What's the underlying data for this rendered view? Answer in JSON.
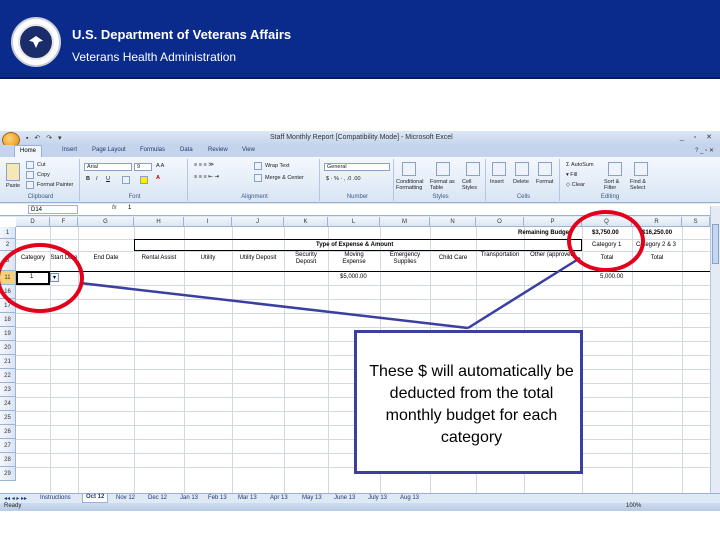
{
  "header": {
    "title": "U.S. Department of Veterans Affairs",
    "subtitle": "Veterans Health Administration"
  },
  "window": {
    "title": "Staff Monthly Report [Compatibility Mode] - Microsoft Excel"
  },
  "ribbon": {
    "tabs": [
      "Home",
      "Insert",
      "Page Layout",
      "Formulas",
      "Data",
      "Review",
      "View"
    ],
    "active_tab": "Home",
    "clipboard": {
      "label": "Clipboard",
      "paste": "Paste",
      "cut": "Cut",
      "copy": "Copy",
      "format_painter": "Format Painter"
    },
    "font": {
      "label": "Font",
      "name": "Arial",
      "size": "9"
    },
    "alignment": {
      "label": "Alignment",
      "wrap_text": "Wrap Text",
      "merge_center": "Merge & Center"
    },
    "number": {
      "label": "Number",
      "format": "General"
    },
    "styles": {
      "label": "Styles",
      "conditional": "Conditional Formatting",
      "format_table": "Format as Table",
      "cell_styles": "Cell Styles"
    },
    "cells": {
      "label": "Cells",
      "insert": "Insert",
      "delete": "Delete",
      "format": "Format"
    },
    "editing": {
      "label": "Editing",
      "autosum": "AutoSum",
      "fill": "Fill",
      "clear": "Clear",
      "sort_filter": "Sort & Filter",
      "find_select": "Find & Select"
    }
  },
  "formula_bar": {
    "name_box": "D14",
    "fx": "fx",
    "content": "1"
  },
  "grid": {
    "columns": [
      "D",
      "F",
      "G",
      "H",
      "I",
      "J",
      "K",
      "L",
      "M",
      "N",
      "O",
      "P",
      "Q",
      "R",
      "S"
    ],
    "rows": [
      "1",
      "2",
      "3",
      "11",
      "16",
      "17",
      "18",
      "19",
      "20",
      "21",
      "22",
      "23",
      "24",
      "25",
      "26",
      "27",
      "28",
      "29"
    ],
    "remaining_budget_label": "Remaining Budget",
    "remaining_budget_values": [
      "$3,750.00",
      "$16,250.00"
    ],
    "type_of_expense_header": "Type of Expense & Amount",
    "category_headers": [
      "Category 1",
      "Category 2 & 3"
    ],
    "column_headers": [
      "Category",
      "Start Date",
      "End Date",
      "Rental Assist",
      "Utility",
      "Utility Deposit",
      "Security Deposit",
      "Moving Expense",
      "Emergency Supplies",
      "Child Care",
      "Transportation",
      "Other (approved)",
      "Total",
      "Total"
    ],
    "row_values": {
      "category": "1",
      "moving_expense": "$5,000.00",
      "total": "5,000.00"
    }
  },
  "sheet_tabs": {
    "tabs": [
      "Instructions",
      "Oct 12",
      "Nov 12",
      "Dec 12",
      "Jan 13",
      "Feb 13",
      "Mar 13",
      "Apr 13",
      "May 13",
      "June 13",
      "July 13",
      "Aug 13"
    ],
    "active": "Oct 12"
  },
  "status_bar": {
    "ready": "Ready",
    "zoom": "100%"
  },
  "callout": {
    "text": "These $ will automatically be deducted from the total monthly budget for each category"
  },
  "colors": {
    "header_bg": "#0a2a8c",
    "annotation_circle": "#e2001a",
    "callout_border": "#3a3fa0"
  }
}
